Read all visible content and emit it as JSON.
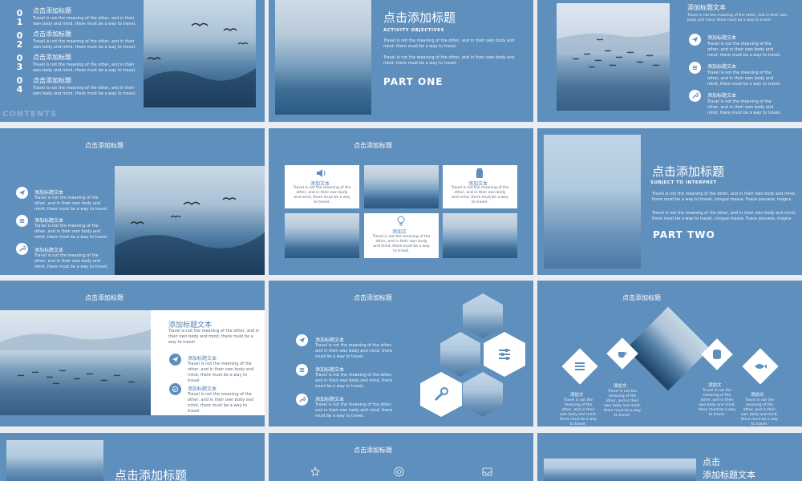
{
  "colors": {
    "slide_bg": "#5f8fbd",
    "accent": "#4f7fb0",
    "dark_text": "#5a6b7e"
  },
  "slide1": {
    "numbers": [
      "01",
      "02",
      "03",
      "04"
    ],
    "contents_label": "CONTENTS",
    "items": [
      {
        "title": "点击添加标题",
        "text": "Travel is not the meaning of the other, and in their own body and mind, there must be a way to travel."
      },
      {
        "title": "点击添加标题",
        "text": "Travel is not the meaning of the other, and in their own body and mind, there must be a way to travel."
      },
      {
        "title": "点击添加标题",
        "text": "Travel is not the meaning of the other, and in their own body and mind, there must be a way to travel."
      },
      {
        "title": "点击添加标题",
        "text": "Travel is not the meaning of the other, and in their own body and mind, there must be a way to travel."
      }
    ]
  },
  "slide2": {
    "title": "点击添加标题",
    "kicker": "ACTIVITY OBJECTIVES",
    "p1": "Travel is not the meaning of the other, and in their own body and mind, there must be a way to travel.",
    "p2": "Travel is not the meaning of the other, and in their own body and mind, there must be a way to travel.",
    "part": "PART ONE"
  },
  "slide3": {
    "heading": "添加标题文本",
    "heading_text": "Travel is not the meaning of the other, and in their own body and mind, there must be a way to travel.",
    "items": [
      {
        "title": "添加标题文本",
        "text": "Travel is not the meaning of the other, and in their own body and mind, there must be a way to travel."
      },
      {
        "title": "添加标题文本",
        "text": "Travel is not the meaning of the other, and in their own body and mind, there must be a way to travel."
      },
      {
        "title": "添加标题文本",
        "text": "Travel is not the meaning of the other, and in their own body and mind, there must be a way to travel."
      }
    ]
  },
  "slide4": {
    "title": "点击添加标题",
    "items": [
      {
        "title": "添加标题文本",
        "text": "Travel is not the meaning of the other, and in their own body and mind, there must be a way to travel."
      },
      {
        "title": "添加标题文本",
        "text": "Travel is not the meaning of the other, and in their own body and mind, there must be a way to travel."
      },
      {
        "title": "添加标题文本",
        "text": "Travel is not the meaning of the other, and in their own body and mind, there must be a way to travel."
      }
    ]
  },
  "slide5": {
    "title": "点击添加标题",
    "cards": [
      {
        "title": "添加文本",
        "text": "Travel is not the meaning of the other, and in their own body and mind, there must be a way to travel."
      },
      {
        "title": "添加文本",
        "text": "Travel is not the meaning of the other, and in their own body and mind, there must be a way to travel."
      },
      {
        "title": "添加文",
        "text": "Travel is not the meaning of the other, and in their own body and mind, there must be a way to travel."
      }
    ]
  },
  "slide6": {
    "title": "点击添加标题",
    "kicker": "SUBJECT TO INTERPRET",
    "p1": "Travel is not the meaning of the other, and in their own body and mind, there must be a way to travel. congue massa. Fusce posuere, magna",
    "p2": "Travel is not the meaning of the other, and in their own body and mind, there must be a way to travel. congue massa. Fusce posuere, magna",
    "part": "PART TWO"
  },
  "slide7": {
    "title": "点击添加标题",
    "heading": "添加标题文本",
    "heading_text": "Travel is not the meaning of the other, and in their own body and mind, there must be a way to travel.",
    "items": [
      {
        "title": "添加标题文本",
        "text": "Travel is not the meaning of the other, and in their own body and mind, there must be a way to travel."
      },
      {
        "title": "添加标题文本",
        "text": "Travel is not the meaning of the other, and in their own body and mind, there must be a way to travel."
      }
    ]
  },
  "slide8": {
    "title": "点击添加标题",
    "items": [
      {
        "title": "添加标题文本",
        "text": "Travel is not the meaning of the other, and in their own body and mind, there must be a way to travel."
      },
      {
        "title": "添加标题文本",
        "text": "Travel is not the meaning of the other, and in their own body and mind, there must be a way to travel."
      },
      {
        "title": "添加标题文本",
        "text": "Travel is not the meaning of the other, and in their own body and mind, there must be a way to travel."
      }
    ]
  },
  "slide9": {
    "title": "点击添加标题",
    "items": [
      {
        "title": "添加文",
        "text": "Travel is not the meaning of the other, and in their own body and mind, there must be a way to travel."
      },
      {
        "title": "添加文",
        "text": "Travel is not the meaning of the other, and in their own body and mind, there must be a way to travel."
      },
      {
        "title": "添加文",
        "text": "Travel is not the meaning of the other, and in their own body and mind, there must be a way to travel."
      },
      {
        "title": "添加文",
        "text": "Travel is not the meaning of the other, and in their own body and mind, there must be a way to travel."
      }
    ]
  },
  "slide10": {
    "title": "点击添加标题"
  },
  "slide11": {
    "title": "点击添加标题"
  },
  "slide12": {
    "title": "点击",
    "subtitle": "添加标题文本"
  }
}
